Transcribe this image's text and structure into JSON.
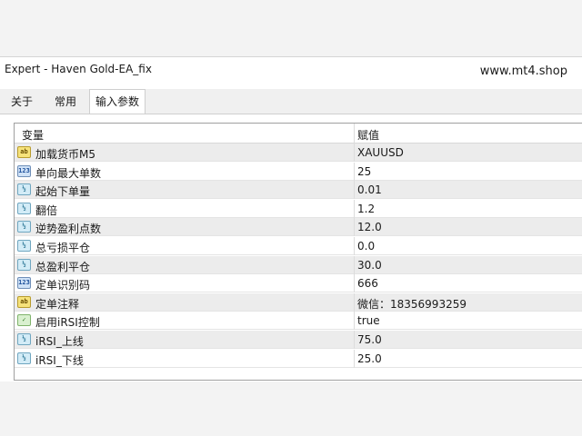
{
  "window": {
    "title": "Expert - Haven Gold-EA_fix",
    "watermark": "www.mt4.shop"
  },
  "tabs": [
    {
      "label": "关于",
      "active": false
    },
    {
      "label": "常用",
      "active": false
    },
    {
      "label": "输入参数",
      "active": true
    }
  ],
  "grid": {
    "columns": {
      "variable": "变量",
      "value": "赋值"
    },
    "rows": [
      {
        "icon": "string-type-icon",
        "icon_text": "ab",
        "kind": "str",
        "name": "加载货币M5",
        "value": "XAUUSD"
      },
      {
        "icon": "integer-type-icon",
        "icon_text": "123",
        "kind": "int",
        "name": "单向最大单数",
        "value": "25"
      },
      {
        "icon": "double-type-icon",
        "icon_text": "½",
        "kind": "dbl",
        "name": "起始下单量",
        "value": "0.01"
      },
      {
        "icon": "double-type-icon",
        "icon_text": "½",
        "kind": "dbl",
        "name": "翻倍",
        "value": "1.2"
      },
      {
        "icon": "double-type-icon",
        "icon_text": "½",
        "kind": "dbl",
        "name": "逆势盈利点数",
        "value": "12.0"
      },
      {
        "icon": "double-type-icon",
        "icon_text": "½",
        "kind": "dbl",
        "name": "总亏损平仓",
        "value": "0.0"
      },
      {
        "icon": "double-type-icon",
        "icon_text": "½",
        "kind": "dbl",
        "name": "总盈利平仓",
        "value": "30.0"
      },
      {
        "icon": "integer-type-icon",
        "icon_text": "123",
        "kind": "int",
        "name": "定单识别码",
        "value": "666"
      },
      {
        "icon": "string-type-icon",
        "icon_text": "ab",
        "kind": "str",
        "name": "定单注释",
        "value": "微信：18356993259"
      },
      {
        "icon": "bool-type-icon",
        "icon_text": "✓",
        "kind": "bool",
        "name": "启用iRSI控制",
        "value": "true"
      },
      {
        "icon": "double-type-icon",
        "icon_text": "½",
        "kind": "dbl",
        "name": "iRSI_上线",
        "value": "75.0"
      },
      {
        "icon": "double-type-icon",
        "icon_text": "½",
        "kind": "dbl",
        "name": "iRSI_下线",
        "value": "25.0"
      }
    ]
  }
}
